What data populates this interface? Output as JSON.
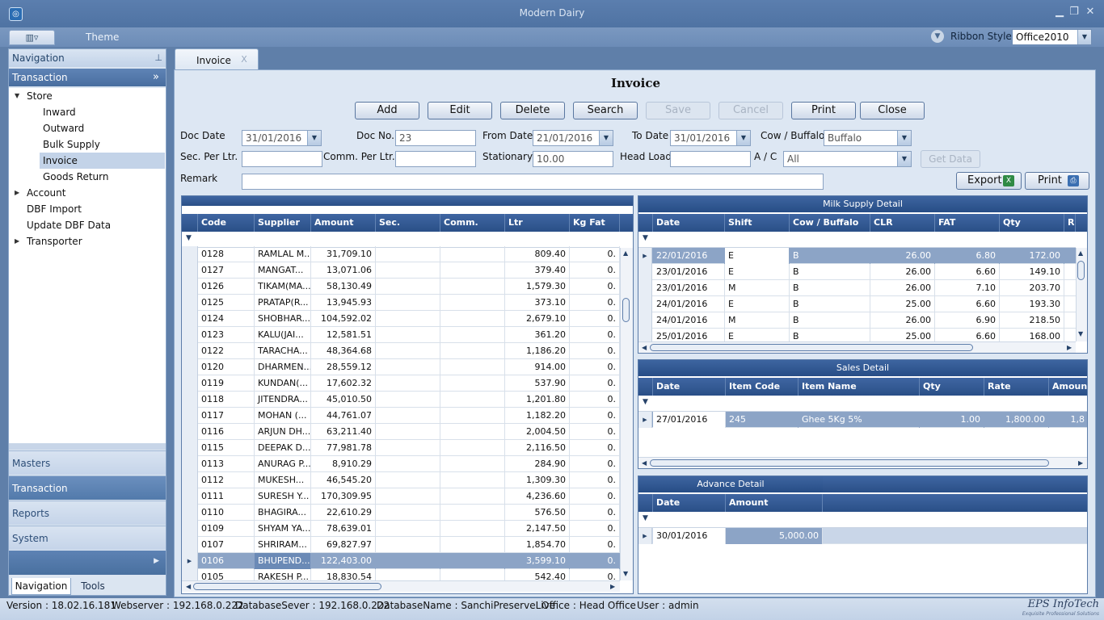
{
  "window": {
    "title": "Modern Dairy"
  },
  "ribbon": {
    "theme_tab": "Theme",
    "style_label": "Ribbon Style:",
    "style_value": "Office2010"
  },
  "nav": {
    "header": "Navigation",
    "group": "Transaction",
    "tree": [
      {
        "label": "Store",
        "level": 0,
        "expanded": true
      },
      {
        "label": "Inward",
        "level": 1
      },
      {
        "label": "Outward",
        "level": 1
      },
      {
        "label": "Bulk Supply",
        "level": 1
      },
      {
        "label": "Invoice",
        "level": 1,
        "selected": true
      },
      {
        "label": "Goods Return",
        "level": 1
      },
      {
        "label": "Account",
        "level": 0,
        "expanded": false
      },
      {
        "label": "DBF Import",
        "level": 0
      },
      {
        "label": "Update DBF Data",
        "level": 0
      },
      {
        "label": "Transporter",
        "level": 0,
        "expanded": false
      }
    ],
    "groups": [
      "Masters",
      "Transaction",
      "Reports",
      "System"
    ],
    "tabs": [
      "Navigation",
      "Tools"
    ]
  },
  "doc_tab": {
    "label": "Invoice",
    "close": "X"
  },
  "form": {
    "title": "Invoice",
    "buttons": [
      "Add",
      "Edit",
      "Delete",
      "Search",
      "Save",
      "Cancel",
      "Print",
      "Close"
    ],
    "doc_date_label": "Doc Date",
    "doc_date": "31/01/2016",
    "doc_no_label": "Doc No.",
    "doc_no": "23",
    "from_date_label": "From Date",
    "from_date": "21/01/2016",
    "to_date_label": "To Date",
    "to_date": "31/01/2016",
    "cow_buffalo_label": "Cow / Buffalo",
    "cow_buffalo": "Buffalo",
    "sec_label": "Sec. Per Ltr.",
    "sec": "",
    "comm_label": "Comm. Per Ltr.",
    "comm": "",
    "stationary_label": "Stationary",
    "stationary": "10.00",
    "headload_label": "Head Load",
    "headload": "",
    "ac_label": "A / C",
    "ac": "All",
    "getdata_label": "Get Data",
    "remark_label": "Remark",
    "remark": "",
    "export_label": "Export",
    "print2_label": "Print"
  },
  "main_grid": {
    "columns": [
      "Code",
      "Supplier",
      "Amount",
      "Sec.",
      "Comm.",
      "Ltr",
      "Kg Fat"
    ],
    "rows": [
      [
        "0128",
        "RAMLAL M...",
        "31,709.10",
        "",
        "",
        "809.40",
        "0."
      ],
      [
        "0127",
        "MANGAT...",
        "13,071.06",
        "",
        "",
        "379.40",
        "0."
      ],
      [
        "0126",
        "TIKAM(MA...",
        "58,130.49",
        "",
        "",
        "1,579.30",
        "0."
      ],
      [
        "0125",
        "PRATAP(R...",
        "13,945.93",
        "",
        "",
        "373.10",
        "0."
      ],
      [
        "0124",
        "SHOBHAR...",
        "104,592.02",
        "",
        "",
        "2,679.10",
        "0."
      ],
      [
        "0123",
        "KALU(JAI...",
        "12,581.51",
        "",
        "",
        "361.20",
        "0."
      ],
      [
        "0122",
        "TARACHA...",
        "48,364.68",
        "",
        "",
        "1,186.20",
        "0."
      ],
      [
        "0120",
        "DHARMEN...",
        "28,559.12",
        "",
        "",
        "914.00",
        "0."
      ],
      [
        "0119",
        "KUNDAN(...",
        "17,602.32",
        "",
        "",
        "537.90",
        "0."
      ],
      [
        "0118",
        "JITENDRA...",
        "45,010.50",
        "",
        "",
        "1,201.80",
        "0."
      ],
      [
        "0117",
        "MOHAN (...",
        "44,761.07",
        "",
        "",
        "1,182.20",
        "0."
      ],
      [
        "0116",
        "ARJUN DH...",
        "63,211.40",
        "",
        "",
        "2,004.50",
        "0."
      ],
      [
        "0115",
        "DEEPAK D...",
        "77,981.78",
        "",
        "",
        "2,116.50",
        "0."
      ],
      [
        "0113",
        "ANURAG P...",
        "8,910.29",
        "",
        "",
        "284.90",
        "0."
      ],
      [
        "0112",
        "MUKESH...",
        "46,545.20",
        "",
        "",
        "1,309.30",
        "0."
      ],
      [
        "0111",
        "SURESH Y...",
        "170,309.95",
        "",
        "",
        "4,236.60",
        "0."
      ],
      [
        "0110",
        "BHAGIRA...",
        "22,610.29",
        "",
        "",
        "576.50",
        "0."
      ],
      [
        "0109",
        "SHYAM YA...",
        "78,639.01",
        "",
        "",
        "2,147.50",
        "0."
      ],
      [
        "0107",
        "SHRIRAM...",
        "69,827.97",
        "",
        "",
        "1,854.70",
        "0."
      ],
      [
        "0106",
        "BHUPEND...",
        "122,403.00",
        "",
        "",
        "3,599.10",
        "0."
      ],
      [
        "0105",
        "RAKESH P...",
        "18,830.54",
        "",
        "",
        "542.40",
        "0."
      ]
    ],
    "selected_row": 19
  },
  "milk_grid": {
    "title": "Milk Supply Detail",
    "columns": [
      "Date",
      "Shift",
      "Cow / Buffalo",
      "CLR",
      "FAT",
      "Qty",
      "R"
    ],
    "rows": [
      [
        "22/01/2016",
        "E",
        "B",
        "26.00",
        "6.80",
        "172.00"
      ],
      [
        "23/01/2016",
        "E",
        "B",
        "26.00",
        "6.60",
        "149.10"
      ],
      [
        "23/01/2016",
        "M",
        "B",
        "26.00",
        "7.10",
        "203.70"
      ],
      [
        "24/01/2016",
        "E",
        "B",
        "25.00",
        "6.60",
        "193.30"
      ],
      [
        "24/01/2016",
        "M",
        "B",
        "26.00",
        "6.90",
        "218.50"
      ],
      [
        "25/01/2016",
        "E",
        "B",
        "25.00",
        "6.60",
        "168.00"
      ]
    ],
    "selected_row": 0
  },
  "sales_grid": {
    "title": "Sales Detail",
    "columns": [
      "Date",
      "Item Code",
      "Item Name",
      "Qty",
      "Rate",
      "Amount"
    ],
    "rows": [
      [
        "27/01/2016",
        "245",
        "Ghee 5Kg 5%",
        "1.00",
        "1,800.00",
        "1,8"
      ]
    ]
  },
  "advance_grid": {
    "title": "Advance Detail",
    "columns": [
      "Date",
      "Amount"
    ],
    "rows": [
      [
        "30/01/2016",
        "5,000.00"
      ]
    ]
  },
  "status": {
    "version": "Version : 18.02.16.181",
    "webserver": "Webserver : 192.168.0.222",
    "dbserver": "DatabaseSever : 192.168.0.222",
    "dbname": "DatabaseName : SanchiPreserveLive",
    "office": "Office : Head Office",
    "user": "User : admin",
    "brand": "EPS InfoTech",
    "brand_sub": "Exquisite Professional Solutions"
  }
}
